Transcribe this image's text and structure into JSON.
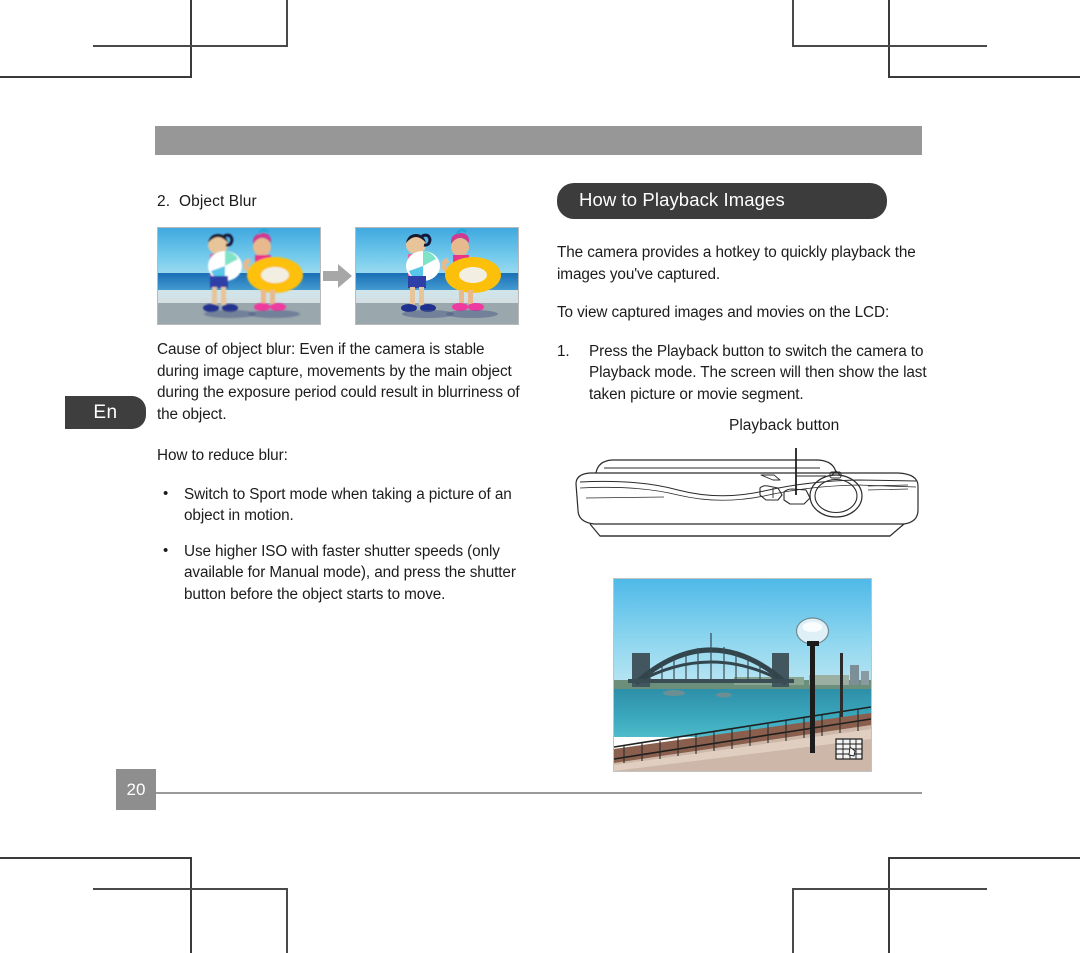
{
  "document": {
    "page_number": "20",
    "language_tab": "En"
  },
  "left_column": {
    "section_number": "2.",
    "section_title": "Object Blur",
    "figure": {
      "before_alt": "blurred-beach-photo",
      "after_alt": "sharp-beach-photo",
      "arrow_alt": "right-arrow"
    },
    "cause_paragraph": "Cause of object blur: Even if the camera is stable during image capture, movements by the main object during the exposure period could result in blurriness of the object.",
    "reduce_heading": "How to reduce blur:",
    "bullets": [
      "Switch to Sport mode when taking a picture of an object in motion.",
      "Use higher ISO with faster shutter speeds (only available for Manual mode), and press the shutter button before the object starts to move."
    ]
  },
  "right_column": {
    "title": "How to Playback Images",
    "intro_paragraph": "The camera provides a hotkey to quickly playback the images you've captured.",
    "lead_in": "To view captured images and movies on the LCD:",
    "steps": [
      {
        "marker": "1.",
        "text": "Press the Playback button to switch the camera to Playback mode. The screen will then show the last taken picture or movie segment."
      }
    ],
    "camera_diagram": {
      "callout_label": "Playback button",
      "alt": "camera-top-view-line-drawing"
    },
    "lcd_preview": {
      "alt": "sydney-harbour-bridge-photo",
      "overlay_icon": "playback-mode-icon"
    }
  },
  "colors": {
    "header_bar": "#979797",
    "pill_dark": "#3c3c3c",
    "tab_dark": "#3e3e3e",
    "page_num_gray": "#8e8e8e",
    "rule_gray": "#9a9a9a",
    "text": "#1c1c1c"
  }
}
